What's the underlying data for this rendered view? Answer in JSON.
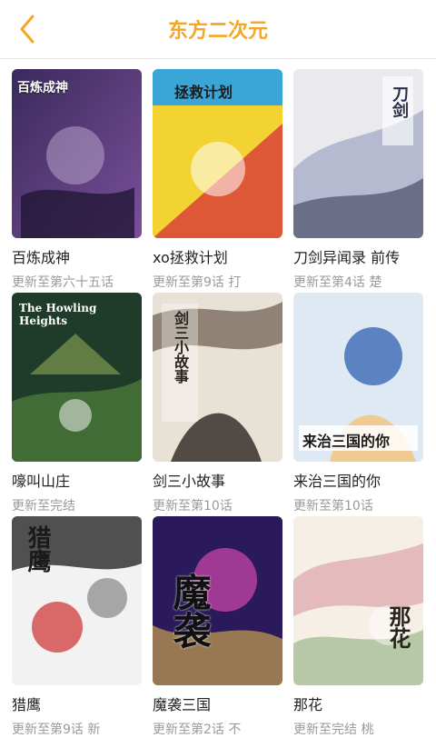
{
  "header": {
    "title": "东方二次元",
    "back_icon": "chevron-left-icon",
    "accent": "#f5a623"
  },
  "comics": [
    {
      "name": "百炼成神",
      "sub": "更新至第六十五话",
      "cover_text": "百炼成神",
      "cover_colors": [
        "#3a2a5c",
        "#7a4f9a",
        "#b7a3c9"
      ]
    },
    {
      "name": "xo拯救计划",
      "sub": "更新至第9话 打",
      "cover_text": "拯救计划",
      "cover_colors": [
        "#f3d332",
        "#3aa6d8",
        "#d83a3a"
      ]
    },
    {
      "name": "刀剑异闻录 前传",
      "sub": "更新至第4话 楚",
      "cover_text": "刀剑",
      "cover_colors": [
        "#e9e9ee",
        "#8c94b8",
        "#2c2f48"
      ]
    },
    {
      "name": "嚎叫山庄",
      "sub": "更新至完结",
      "cover_text": "The Howling Heights",
      "cover_colors": [
        "#1f3b2a",
        "#4d7d3a",
        "#c8e06a"
      ]
    },
    {
      "name": "剑三小故事",
      "sub": "更新至第10话",
      "cover_text": "剑三小故事",
      "cover_colors": [
        "#e8e1d6",
        "#6b5b4d",
        "#2a2420"
      ]
    },
    {
      "name": "来治三国的你",
      "sub": "更新至第10话",
      "cover_text": "来治三国的你",
      "cover_colors": [
        "#dfe9f3",
        "#2f5fb0",
        "#f2c27a"
      ]
    },
    {
      "name": "猎鹰",
      "sub": "更新至第9话 新",
      "cover_text": "猎鹰",
      "cover_colors": [
        "#f2f2f2",
        "#1a1a1a",
        "#d03a3a"
      ]
    },
    {
      "name": "魔袭三国",
      "sub": "更新至第2话 不",
      "cover_text": "魔袭",
      "cover_colors": [
        "#2a1a5c",
        "#e04ab0",
        "#f3c64a"
      ]
    },
    {
      "name": "那花",
      "sub": "更新至完结 桃",
      "cover_text": "那花",
      "cover_colors": [
        "#f6efe6",
        "#d07a8c",
        "#6a9a58"
      ]
    }
  ]
}
